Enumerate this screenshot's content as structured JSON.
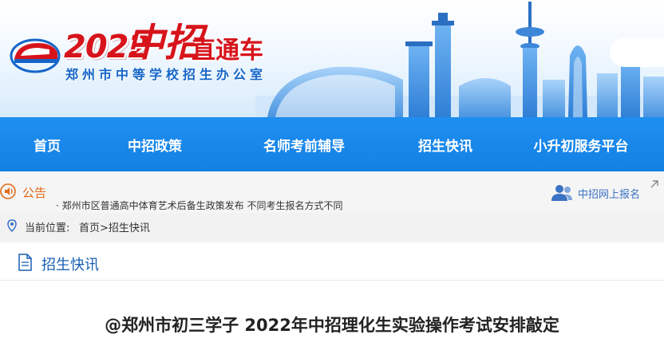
{
  "banner": {
    "year": "2022",
    "title_big": "中招",
    "title_small": "直通车",
    "subtitle": "郑州市中等学校招生办公室",
    "brand_color": "#d7141b",
    "sub_color": "#1565c8"
  },
  "nav": {
    "items": [
      {
        "label": "首页"
      },
      {
        "label": "中招政策"
      },
      {
        "label": "名师考前辅导"
      },
      {
        "label": "招生快讯"
      },
      {
        "label": "小升初服务平台"
      }
    ],
    "bg_color": "#1785ea"
  },
  "notice": {
    "label": "公告",
    "ticker": "· 郑州市区普通高中体育艺术后备生政策发布 不同考生报名方式不同",
    "signup": "中招网上报名",
    "icons": {
      "speaker": "speaker-icon",
      "users": "users-icon",
      "chevron": "chevron-up-right-icon"
    }
  },
  "breadcrumb": {
    "label": "当前位置:",
    "home": "首页",
    "separator": ">",
    "current": "招生快讯"
  },
  "section": {
    "title": "招生快讯",
    "article_title": "@郑州市初三学子 2022年中招理化生实验操作考试安排敲定"
  }
}
